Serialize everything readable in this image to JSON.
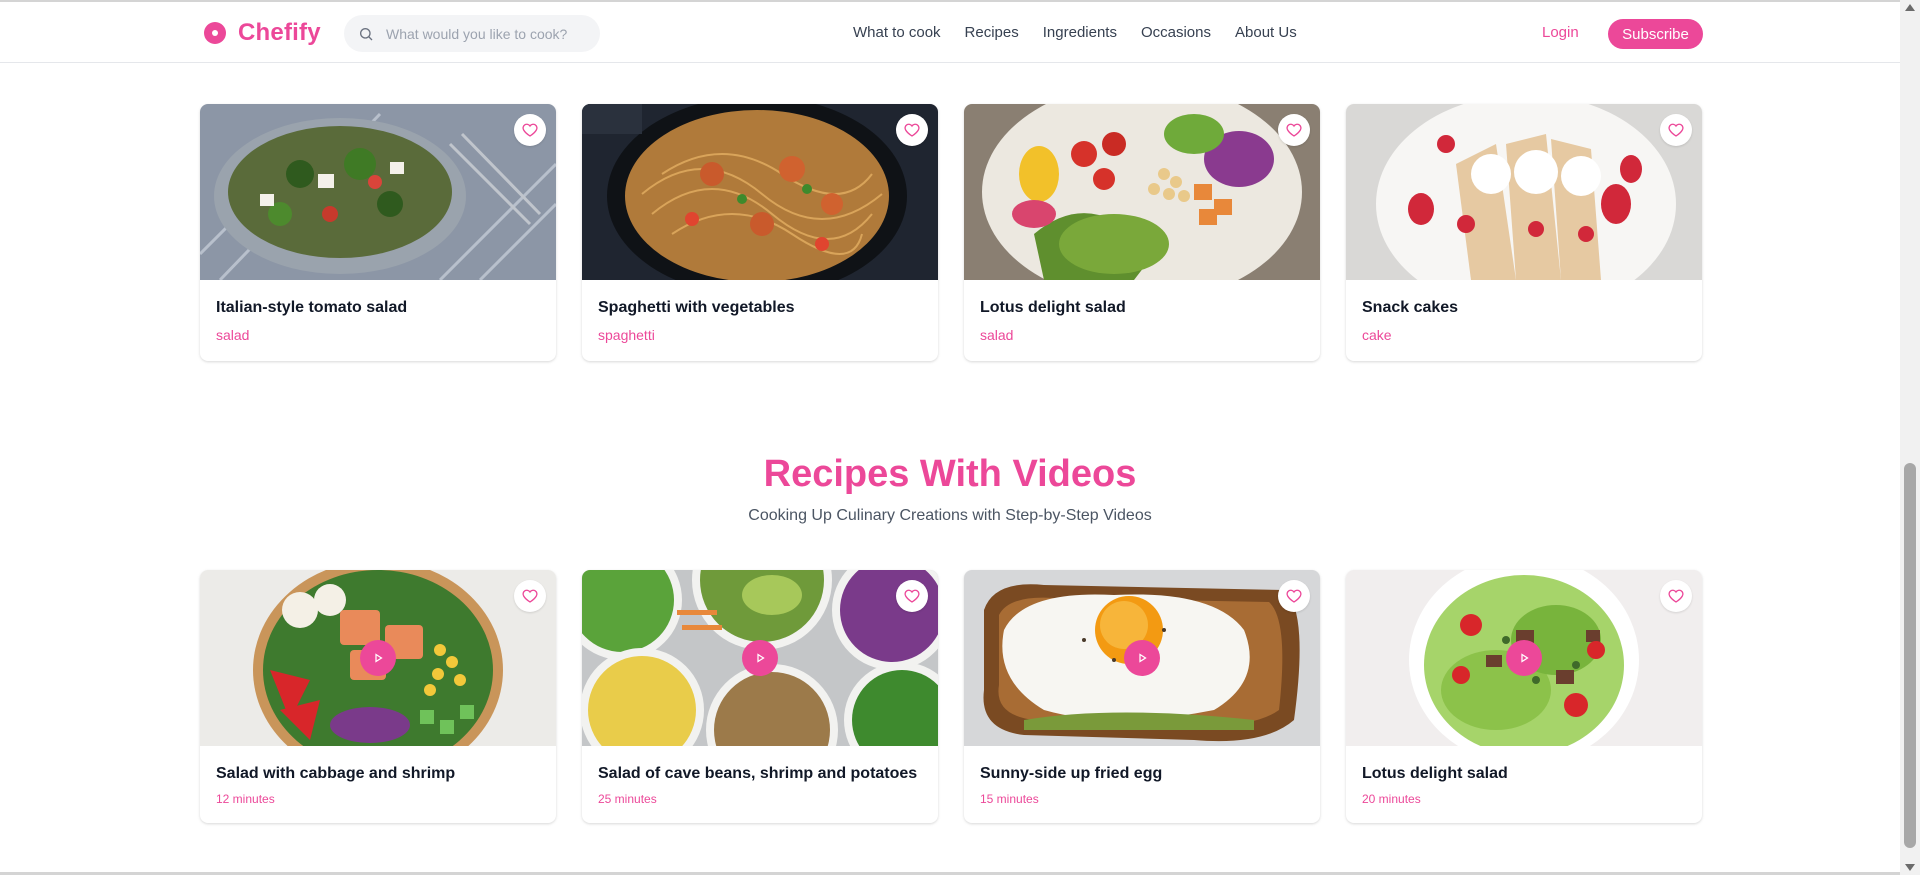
{
  "brand": {
    "name": "Chefify",
    "accent": "#ec4899"
  },
  "search": {
    "placeholder": "What would you like to cook?",
    "value": ""
  },
  "nav": {
    "items": [
      "What to cook",
      "Recipes",
      "Ingredients",
      "Occasions",
      "About Us"
    ]
  },
  "auth": {
    "login": "Login",
    "subscribe": "Subscribe"
  },
  "top_cards": [
    {
      "title": "Italian-style tomato salad",
      "tag": "salad",
      "image": "tomato-salad-bowl"
    },
    {
      "title": "Spaghetti with vegetables",
      "tag": "spaghetti",
      "image": "spaghetti-shrimp-pan"
    },
    {
      "title": "Lotus delight salad",
      "tag": "salad",
      "image": "veggie-bowl"
    },
    {
      "title": "Snack cakes",
      "tag": "cake",
      "image": "crepes-cream-strawberries"
    }
  ],
  "video_section": {
    "title": "Recipes With Videos",
    "subtitle": "Cooking Up Culinary Creations with Step-by-Step Videos"
  },
  "video_cards": [
    {
      "title": "Salad with cabbage and shrimp",
      "time": "12 minutes",
      "image": "salmon-bowl"
    },
    {
      "title": "Salad of cave beans, shrimp and potatoes",
      "time": "25 minutes",
      "image": "salad-bowls-platter"
    },
    {
      "title": "Sunny-side up fried egg",
      "time": "15 minutes",
      "image": "egg-toast"
    },
    {
      "title": "Lotus delight salad",
      "time": "20 minutes",
      "image": "green-salad-bowl"
    }
  ],
  "icons": {
    "logo": "donut-logo-icon",
    "search": "search-icon",
    "favorite": "heart-icon",
    "play": "play-icon"
  }
}
